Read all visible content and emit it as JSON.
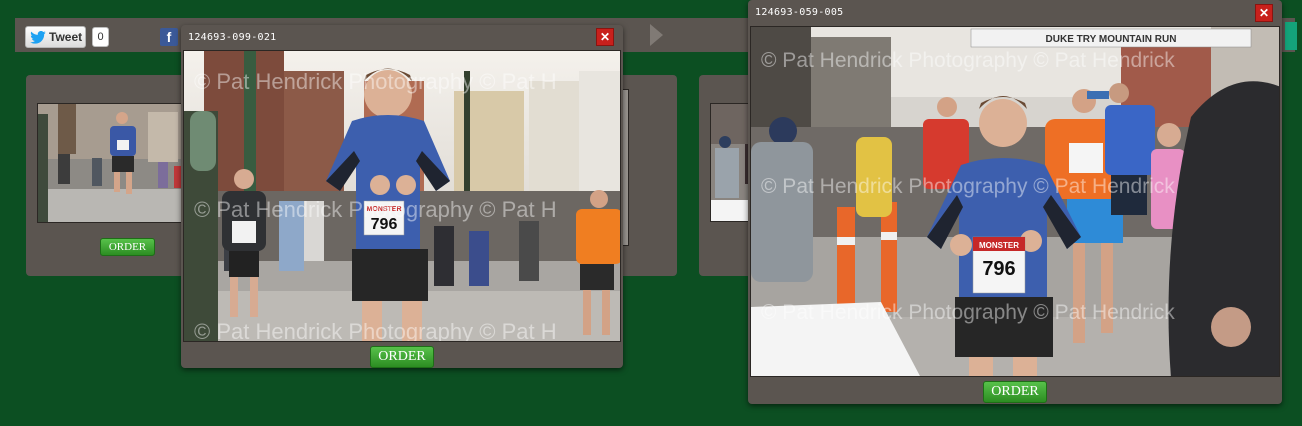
{
  "share_bar": {
    "tweet_label": "Tweet",
    "tweet_count": "0",
    "facebook_glyph": "f"
  },
  "gallery": {
    "order_label": "ORDER"
  },
  "popup_left": {
    "title": "124693-099-021",
    "close_glyph": "✕",
    "watermark": "© Pat Hendrick Photography © Pat H",
    "bib_brand": "MONSTER",
    "bib_number": "796",
    "order_label": "ORDER"
  },
  "popup_right": {
    "title": "124693-059-005",
    "close_glyph": "✕",
    "watermark": "© Pat Hendrick Photography © Pat Hendrick",
    "banner_text": "DUKE TRY MOUNTAIN RUN",
    "bib_brand": "MONSTER",
    "bib_number": "796",
    "order_label": "ORDER"
  },
  "colors": {
    "page_bg": "#0c4f22",
    "panel": "#5b5550",
    "order_green": "#3fa835",
    "close_red": "#c8201c"
  }
}
